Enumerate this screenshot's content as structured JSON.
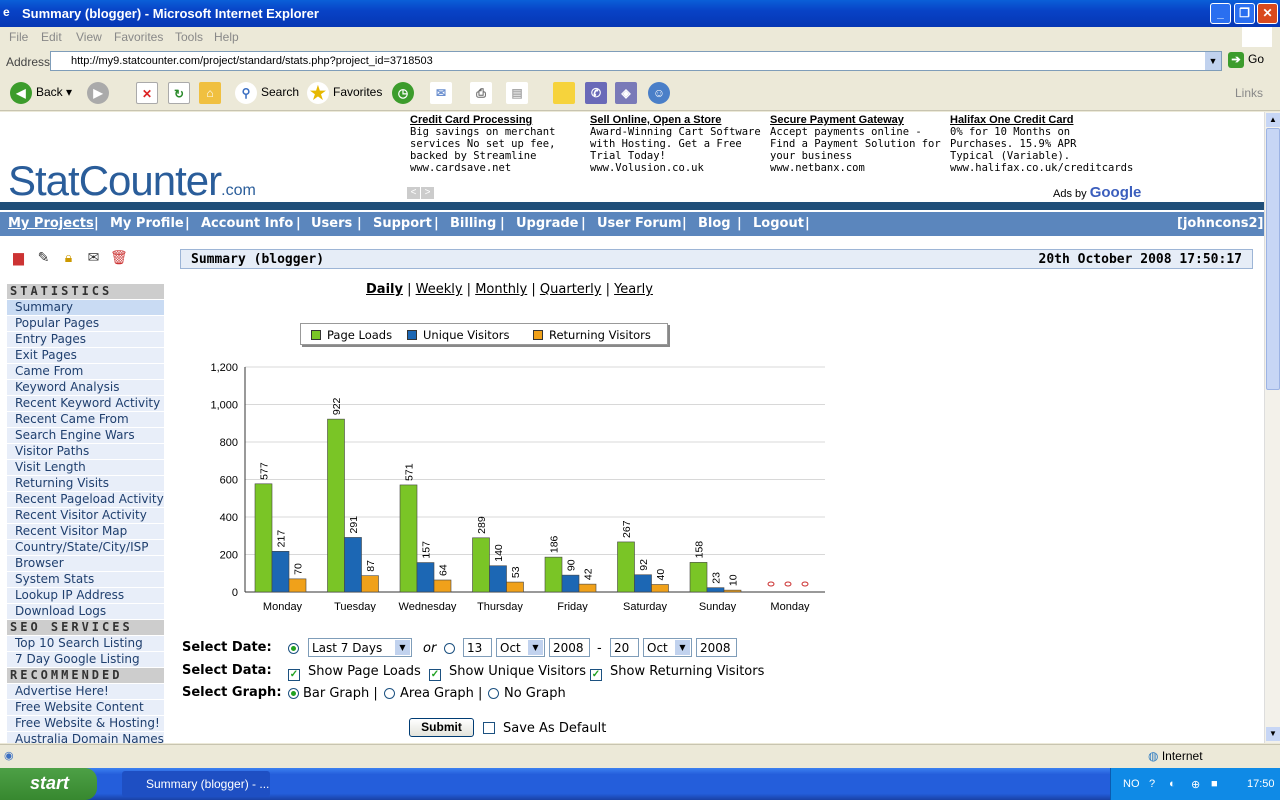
{
  "window": {
    "title": "Summary (blogger) - Microsoft Internet Explorer"
  },
  "menu": [
    "File",
    "Edit",
    "View",
    "Favorites",
    "Tools",
    "Help"
  ],
  "address": {
    "label": "Address",
    "url": "http://my9.statcounter.com/project/standard/stats.php?project_id=3718503",
    "go": "Go"
  },
  "toolbar": {
    "back": "Back",
    "search": "Search",
    "favorites": "Favorites",
    "links": "Links"
  },
  "logo": {
    "text": "StatCounter",
    "suffix": ".com"
  },
  "ads": [
    {
      "title": "Credit Card Processing",
      "body": "Big savings on merchant services No set up fee, backed by Streamline",
      "url": "www.cardsave.net"
    },
    {
      "title": "Sell Online, Open a Store",
      "body": "Award-Winning Cart Software with Hosting. Get a Free Trial Today!",
      "url": "www.Volusion.co.uk"
    },
    {
      "title": "Secure Payment Gateway",
      "body": "Accept payments online - Find a Payment Solution for your business",
      "url": "www.netbanx.com"
    },
    {
      "title": "Halifax One Credit Card",
      "body": "0% for 10 Months on Purchases. 15.9% APR Typical (Variable).",
      "url": "www.halifax.co.uk/creditcards"
    }
  ],
  "ads_by": "Ads by",
  "google": "Google",
  "nav": [
    "My Projects",
    "My Profile",
    "Account Info",
    "Users",
    "Support",
    "Billing",
    "Upgrade",
    "User Forum",
    "Blog",
    "Logout"
  ],
  "nav_user": "[johncons2]",
  "sidebar": {
    "statistics_title": "STATISTICS",
    "statistics": [
      "Summary",
      "Popular Pages",
      "Entry Pages",
      "Exit Pages",
      "Came From",
      "Keyword Analysis",
      "Recent Keyword Activity",
      "Recent Came From",
      "Search Engine Wars",
      "Visitor Paths",
      "Visit Length",
      "Returning Visits",
      "Recent Pageload Activity",
      "Recent Visitor Activity",
      "Recent Visitor Map",
      "Country/State/City/ISP",
      "Browser",
      "System Stats",
      "Lookup IP Address",
      "Download Logs"
    ],
    "seo_title": "SEO SERVICES",
    "seo": [
      "Top 10 Search Listing",
      "7 Day Google Listing"
    ],
    "rec_title": "RECOMMENDED",
    "rec": [
      "Advertise Here!",
      "Free Website Content",
      "Free Website & Hosting!",
      "Australia Domain Names"
    ]
  },
  "main": {
    "title": "Summary (blogger)",
    "datetime": "20th October 2008 17:50:17"
  },
  "periods": [
    "Daily",
    "Weekly",
    "Monthly",
    "Quarterly",
    "Yearly"
  ],
  "chart_data": {
    "type": "bar",
    "categories": [
      "Monday",
      "Tuesday",
      "Wednesday",
      "Thursday",
      "Friday",
      "Saturday",
      "Sunday",
      "Monday"
    ],
    "series": [
      {
        "name": "Page Loads",
        "color": "#7ac526",
        "values": [
          577,
          922,
          571,
          289,
          186,
          267,
          158,
          0
        ]
      },
      {
        "name": "Unique Visitors",
        "color": "#1c67b4",
        "values": [
          217,
          291,
          157,
          140,
          90,
          92,
          23,
          0
        ]
      },
      {
        "name": "Returning Visitors",
        "color": "#f0a11a",
        "values": [
          70,
          87,
          64,
          53,
          42,
          40,
          10,
          0
        ]
      }
    ],
    "ylim": [
      0,
      1200
    ],
    "yticks": [
      "0",
      "200",
      "400",
      "600",
      "800",
      "1,000",
      "1,200"
    ],
    "legend": "top",
    "grid": true
  },
  "form": {
    "select_date_label": "Select Date:",
    "range_value": "Last 7 Days",
    "or": "or",
    "from_day": "13",
    "from_month": "Oct",
    "from_year": "2008",
    "dash": "-",
    "to_day": "20",
    "to_month": "Oct",
    "to_year": "2008",
    "select_data_label": "Select Data:",
    "show_page_loads": "Show Page Loads",
    "show_unique": "Show Unique Visitors",
    "show_returning": "Show Returning Visitors",
    "select_graph_label": "Select Graph:",
    "bar_graph": "Bar Graph |",
    "area_graph": "Area Graph |",
    "no_graph": "No Graph",
    "submit": "Submit",
    "save_default": "Save As Default"
  },
  "status": {
    "zone": "Internet"
  },
  "taskbar": {
    "start": "start",
    "task": "Summary (blogger) - ...",
    "lang": "NO",
    "time": "17:50"
  }
}
